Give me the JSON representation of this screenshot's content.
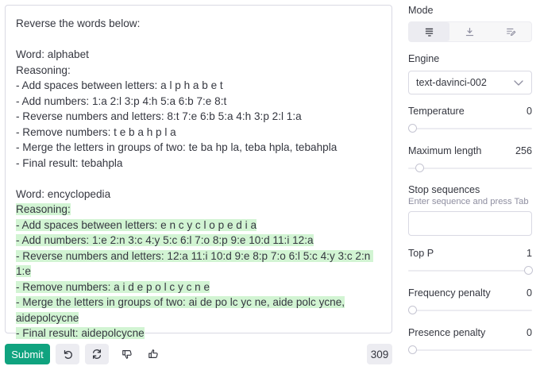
{
  "prompt": {
    "lines": [
      {
        "text": "Reverse the words below:",
        "hl": false
      },
      {
        "text": "",
        "hl": false
      },
      {
        "text": "Word: alphabet",
        "hl": false
      },
      {
        "text": "Reasoning:",
        "hl": false
      },
      {
        "text": "- Add spaces between letters: a l p h a b e t",
        "hl": false
      },
      {
        "text": "- Add numbers: 1:a 2:l 3:p 4:h 5:a 6:b 7:e 8:t",
        "hl": false
      },
      {
        "text": "- Reverse numbers and letters: 8:t 7:e 6:b 5:a 4:h 3:p 2:l 1:a",
        "hl": false
      },
      {
        "text": "- Remove numbers: t e b a h p l a",
        "hl": false
      },
      {
        "text": "- Merge the letters in groups of two: te ba hp la, teba hpla, tebahpla",
        "hl": false
      },
      {
        "text": "- Final result: tebahpla",
        "hl": false
      },
      {
        "text": "",
        "hl": false
      },
      {
        "text": "Word: encyclopedia",
        "hl": false
      },
      {
        "text": "Reasoning:",
        "hl": true
      },
      {
        "text": "- Add spaces between letters: e n c y c l o p e d i a",
        "hl": true
      },
      {
        "text": "- Add numbers: 1:e 2:n 3:c 4:y 5:c 6:l 7:o 8:p 9:e 10:d 11:i 12:a",
        "hl": true
      },
      {
        "text": "- Reverse numbers and letters: 12:a 11:i 10:d 9:e 8:p 7:o 6:l 5:c 4:y 3:c 2:n 1:e",
        "hl": true
      },
      {
        "text": "- Remove numbers: a i d e p o l c y c n e",
        "hl": true
      },
      {
        "text": "- Merge the letters in groups of two: ai de po lc yc ne, aide polc ycne,",
        "hl": true
      },
      {
        "text": "aidepolcycne",
        "hl": true
      },
      {
        "text": "- Final result: aidepolcycne",
        "hl": true
      }
    ]
  },
  "toolbar": {
    "submit_label": "Submit",
    "token_count": "309"
  },
  "settings": {
    "mode_label": "Mode",
    "mode_options": [
      "complete-icon",
      "insert-icon",
      "edit-icon"
    ],
    "mode_selected": 0,
    "engine_label": "Engine",
    "engine_value": "text-davinci-002",
    "temperature_label": "Temperature",
    "temperature_value": "0",
    "temperature_level": 0.0,
    "max_length_label": "Maximum length",
    "max_length_value": "256",
    "max_length_level": 0.06,
    "stop_sequences_label": "Stop sequences",
    "stop_sequences_hint": "Enter sequence and press Tab",
    "top_p_label": "Top P",
    "top_p_value": "1",
    "top_p_level": 1.0,
    "frequency_penalty_label": "Frequency penalty",
    "frequency_penalty_value": "0",
    "frequency_penalty_level": 0.0,
    "presence_penalty_label": "Presence penalty",
    "presence_penalty_value": "0",
    "presence_penalty_level": 0.0
  },
  "colors": {
    "accent": "#10a37f",
    "highlight": "#d2f4d3"
  }
}
